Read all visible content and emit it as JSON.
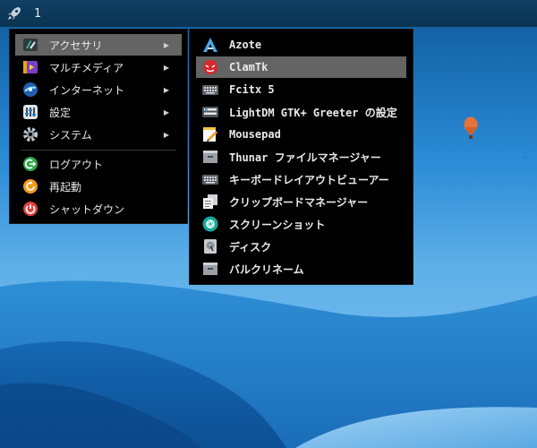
{
  "panel": {
    "workspace": "1",
    "launcher_icon": "rocket-icon"
  },
  "main_menu": {
    "items": [
      {
        "label": "アクセサリ",
        "icon": "accessories-icon",
        "submenu": true,
        "active": true
      },
      {
        "label": "マルチメディア",
        "icon": "multimedia-icon",
        "submenu": true
      },
      {
        "label": "インターネット",
        "icon": "internet-icon",
        "submenu": true
      },
      {
        "label": "設定",
        "icon": "settings-icon",
        "submenu": true
      },
      {
        "label": "システム",
        "icon": "system-gear-icon",
        "submenu": true
      }
    ],
    "session": [
      {
        "label": "ログアウト",
        "icon": "logout-icon"
      },
      {
        "label": "再起動",
        "icon": "reboot-icon"
      },
      {
        "label": "シャットダウン",
        "icon": "shutdown-icon"
      }
    ],
    "arrow": "▶"
  },
  "sub_menu": {
    "items": [
      {
        "label": "Azote",
        "icon": "azote-icon"
      },
      {
        "label": "ClamTk",
        "icon": "clamtk-icon",
        "active": true
      },
      {
        "label": "Fcitx 5",
        "icon": "keyboard-icon"
      },
      {
        "label": "LightDM GTK+ Greeter の設定",
        "icon": "lightdm-icon"
      },
      {
        "label": "Mousepad",
        "icon": "text-editor-icon"
      },
      {
        "label": "Thunar ファイルマネージャー",
        "icon": "file-manager-icon"
      },
      {
        "label": "キーボードレイアウトビューアー",
        "icon": "keyboard-layout-icon"
      },
      {
        "label": "クリップボードマネージャー",
        "icon": "clipboard-icon"
      },
      {
        "label": "スクリーンショット",
        "icon": "screenshot-icon"
      },
      {
        "label": "ディスク",
        "icon": "disk-icon"
      },
      {
        "label": "バルクリネーム",
        "icon": "bulk-rename-icon"
      }
    ]
  },
  "colors": {
    "menu_bg": "#000000",
    "highlight": "#646464",
    "panel": "#0f3f63"
  }
}
